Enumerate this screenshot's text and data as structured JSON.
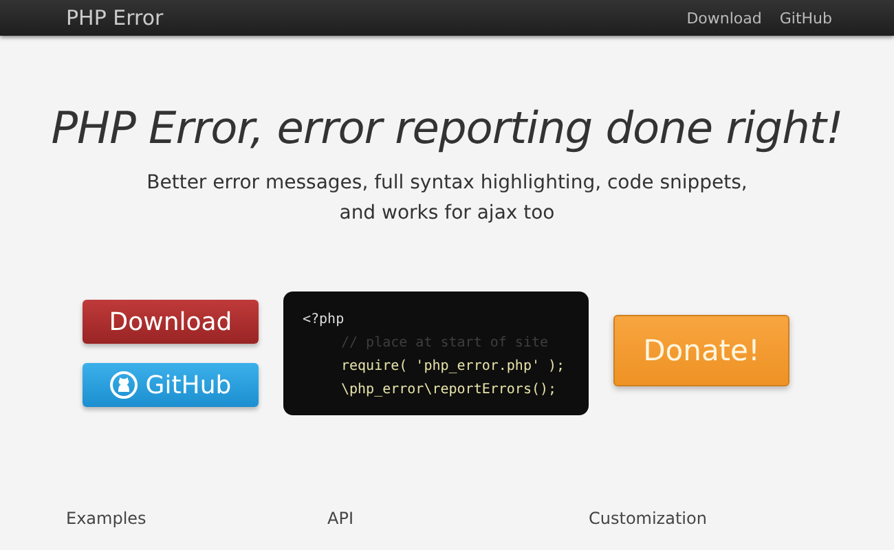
{
  "navbar": {
    "brand": "PHP Error",
    "links": [
      "Download",
      "GitHub"
    ]
  },
  "hero": {
    "title": "PHP Error, error reporting done right!",
    "subtitle_lines": [
      "Better error messages, full syntax highlighting, code snippets,",
      "and works for ajax too"
    ]
  },
  "buttons": [
    {
      "label": "Download",
      "kind": "download"
    },
    {
      "label": "GitHub",
      "kind": "github"
    }
  ],
  "code": [
    {
      "text": "<?php",
      "kind": "tag"
    },
    {
      "text": "// place at start of site",
      "kind": "comment"
    },
    {
      "text": "require( 'php_error.php' );",
      "kind": "code"
    },
    {
      "text": "\\php_error\\reportErrors();",
      "kind": "code"
    }
  ],
  "donate": {
    "label": "Donate!"
  },
  "sections": [
    "Examples",
    "API",
    "Customization"
  ]
}
